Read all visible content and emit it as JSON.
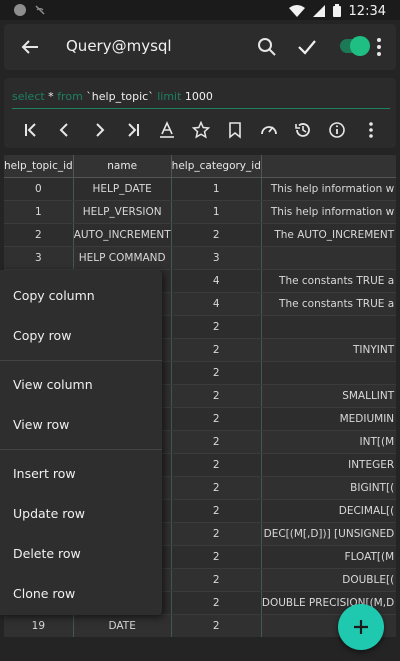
{
  "status": {
    "time": "12:34"
  },
  "appbar": {
    "title": "Query@mysql"
  },
  "query": {
    "kw_select": "select",
    "star": " * ",
    "kw_from": "from",
    "table_name": " `help_topic` ",
    "kw_limit": "limit",
    "limit_value": " 1000"
  },
  "table": {
    "headers": [
      "help_topic_id",
      "name",
      "help_category_id",
      ""
    ],
    "rows": [
      [
        "0",
        "HELP_DATE",
        "1",
        "This help information w"
      ],
      [
        "1",
        "HELP_VERSION",
        "1",
        "This help information w"
      ],
      [
        "2",
        "AUTO_INCREMENT",
        "2",
        "The AUTO_INCREMENT"
      ],
      [
        "3",
        "HELP COMMAND",
        "3",
        ""
      ],
      [
        "",
        "",
        "4",
        "The constants TRUE a"
      ],
      [
        "",
        "",
        "4",
        "The constants TRUE a"
      ],
      [
        "",
        "",
        "2",
        ""
      ],
      [
        "",
        "",
        "2",
        "TINYINT"
      ],
      [
        "",
        "",
        "2",
        ""
      ],
      [
        "",
        "",
        "2",
        "SMALLINT"
      ],
      [
        "",
        "",
        "2",
        "MEDIUMIN"
      ],
      [
        "",
        "",
        "2",
        "INT[(M"
      ],
      [
        "",
        "",
        "2",
        "INTEGER"
      ],
      [
        "",
        "",
        "2",
        "BIGINT[("
      ],
      [
        "",
        "",
        "2",
        "DECIMAL[("
      ],
      [
        "",
        "",
        "2",
        "DEC[(M[,D])] [UNSIGNED"
      ],
      [
        "",
        "",
        "2",
        "FLOAT[(M"
      ],
      [
        "",
        "",
        "2",
        "DOUBLE[("
      ],
      [
        "",
        "ION",
        "2",
        "DOUBLE PRECISION[(M,D"
      ],
      [
        "19",
        "DATE",
        "2",
        ""
      ]
    ]
  },
  "menu": {
    "items": [
      "Copy column",
      "Copy row",
      "View column",
      "View row",
      "Insert row",
      "Update row",
      "Delete row",
      "Clone row"
    ]
  },
  "colors": {
    "accent": "#1fc9b0",
    "keyword": "#1e7f62",
    "toggle": "#1fbf84"
  }
}
